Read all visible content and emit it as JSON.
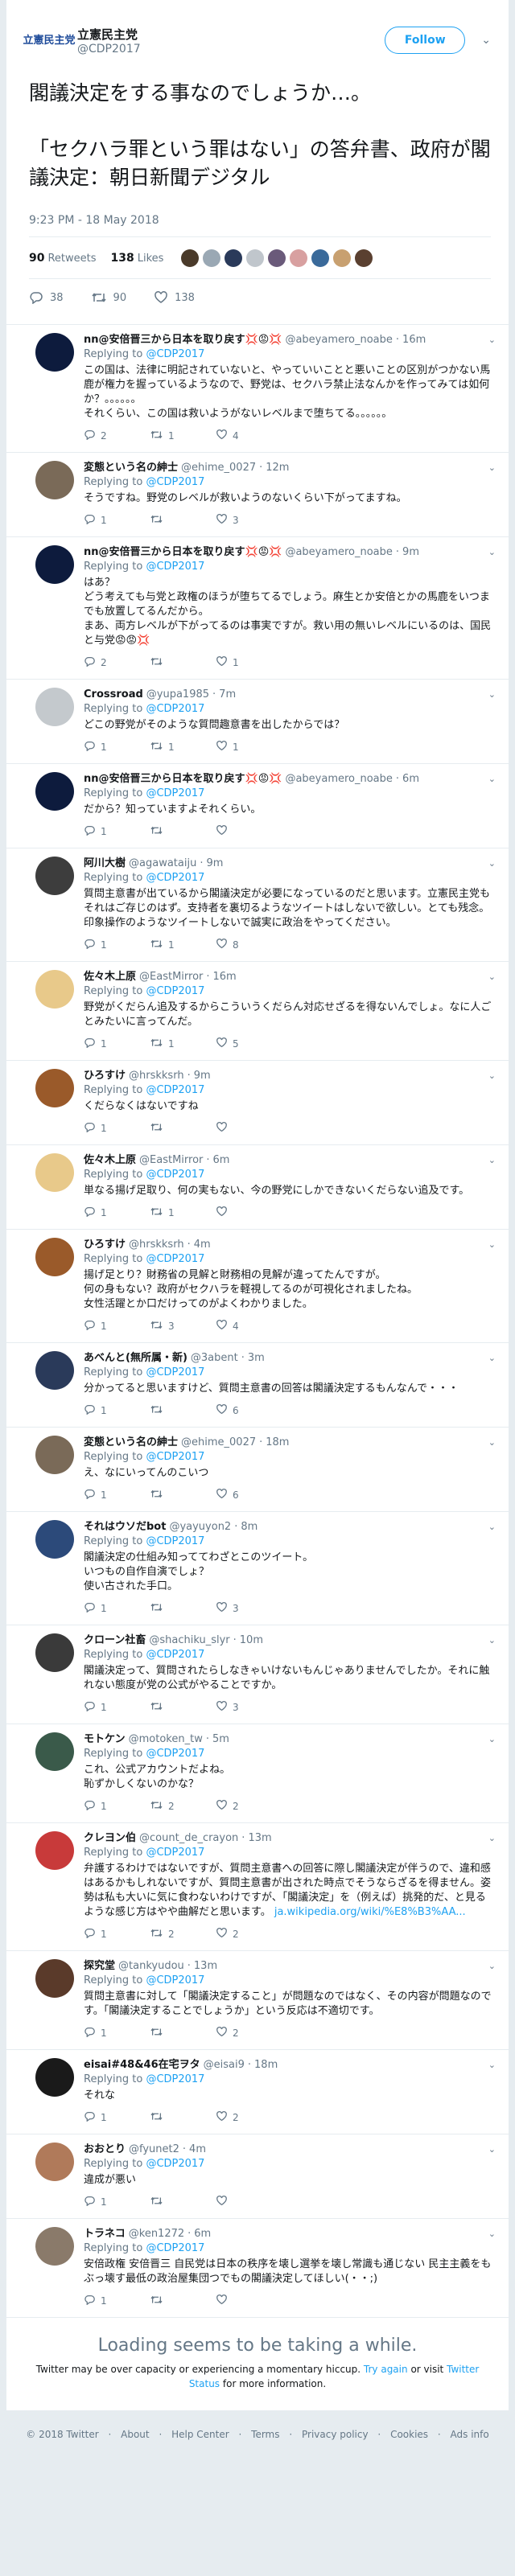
{
  "main": {
    "account_name": "立憲民主党",
    "handle": "@CDP2017",
    "logo_text": "立憲民主党",
    "follow_label": "Follow",
    "text": "閣議決定をする事なのでしょうか…。\n\n「セクハラ罪という罪はない」の答弁書、政府が閣議決定：朝日新聞デジタル",
    "timestamp": "9:23 PM - 18 May 2018",
    "retweets_count": "90",
    "retweets_label": "Retweets",
    "likes_count": "138",
    "likes_label": "Likes",
    "reply_count": "38",
    "retweet_count": "90",
    "like_count": "138"
  },
  "replying_label": "Replying to",
  "replying_handle": "@CDP2017",
  "replies": [
    {
      "name": "nn@安倍晋三から日本を取り戻す💢😡💢",
      "handle": "@abeyamero_noabe",
      "time": "16m",
      "text": "この国は、法律に明記されていないと、やっていいことと悪いことの区別がつかない馬鹿が権力を握っているようなので、野党は、セクハラ禁止法なんかを作ってみては如何か？。。。。。。\nそれくらい、この国は救いようがないレベルまで堕ちてる。。。。。。",
      "reply": "2",
      "rt": "1",
      "like": "4",
      "color": "#0d1b3d"
    },
    {
      "name": "変態という名の紳士",
      "handle": "@ehime_0027",
      "time": "12m",
      "text": "そうですね。野党のレベルが救いようのないくらい下がってますね。",
      "reply": "1",
      "rt": "",
      "like": "3",
      "color": "#7a6a58"
    },
    {
      "name": "nn@安倍晋三から日本を取り戻す💢😡💢",
      "handle": "@abeyamero_noabe",
      "time": "9m",
      "text": "はあ？\nどう考えても与党と政権のほうが堕ちてるでしょう。麻生とか安倍とかの馬鹿をいつまでも放置してるんだから。\nまあ、両方レベルが下がってるのは事実ですが。救い用の無いレベルにいるのは、国民と与党😡😡💢",
      "reply": "2",
      "rt": "",
      "like": "1",
      "color": "#0d1b3d"
    },
    {
      "name": "Crossroad",
      "handle": "@yupa1985",
      "time": "7m",
      "text": "どこの野党がそのような質問趣意書を出したからでは？",
      "reply": "1",
      "rt": "1",
      "like": "1",
      "color": "#c4c9cd"
    },
    {
      "name": "nn@安倍晋三から日本を取り戻す💢😡💢",
      "handle": "@abeyamero_noabe",
      "time": "6m",
      "text": "だから？知っていますよそれくらい。",
      "reply": "1",
      "rt": "",
      "like": "",
      "color": "#0d1b3d"
    },
    {
      "name": "阿川大樹",
      "handle": "@agawataiju",
      "time": "9m",
      "text": "質問主意書が出ているから閣議決定が必要になっているのだと思います。立憲民主党もそれはご存じのはず。支持者を裏切るようなツイートはしないで欲しい。とても残念。印象操作のようなツイートしないで誠実に政治をやってください。",
      "reply": "1",
      "rt": "1",
      "like": "8",
      "color": "#3d3d3d"
    },
    {
      "name": "佐々木上原",
      "handle": "@EastMirror",
      "time": "16m",
      "text": "野党がくだらん追及するからこういうくだらん対応せざるを得ないんでしょ。なに人ごとみたいに言ってんだ。",
      "reply": "1",
      "rt": "1",
      "like": "5",
      "color": "#e8c98a"
    },
    {
      "name": "ひろすけ",
      "handle": "@hrskksrh",
      "time": "9m",
      "text": "くだらなくはないですね",
      "reply": "1",
      "rt": "",
      "like": "",
      "color": "#9a5a2a"
    },
    {
      "name": "佐々木上原",
      "handle": "@EastMirror",
      "time": "6m",
      "text": "単なる揚げ足取り、何の実もない、今の野党にしかできないくだらない追及です。",
      "reply": "1",
      "rt": "1",
      "like": "",
      "color": "#e8c98a"
    },
    {
      "name": "ひろすけ",
      "handle": "@hrskksrh",
      "time": "4m",
      "text": "揚げ足とり？財務省の見解と財務相の見解が違ってたんですが。\n何の身もない？政府がセクハラを軽視してるのが可視化されましたね。\n女性活躍とか口だけってのがよくわかりました。",
      "reply": "1",
      "rt": "3",
      "like": "4",
      "color": "#9a5a2a"
    },
    {
      "name": "あべんと(無所属・新)",
      "handle": "@3abent",
      "time": "3m",
      "text": "分かってると思いますけど、質問主意書の回答は閣議決定するもんなんで・・・",
      "reply": "1",
      "rt": "",
      "like": "6",
      "color": "#2a3a5a"
    },
    {
      "name": "変態という名の紳士",
      "handle": "@ehime_0027",
      "time": "18m",
      "text": "え、なにいってんのこいつ",
      "reply": "1",
      "rt": "",
      "like": "6",
      "color": "#7a6a58"
    },
    {
      "name": "それはウソだbot",
      "handle": "@yayuyon2",
      "time": "8m",
      "text": "閣議決定の仕組み知っててわざとこのツイート。\nいつもの自作自演でしょ？\n使い古された手口。",
      "reply": "1",
      "rt": "",
      "like": "3",
      "color": "#2c4a7a"
    },
    {
      "name": "クローン社畜",
      "handle": "@shachiku_slyr",
      "time": "10m",
      "text": "閣議決定って、質問されたらしなきゃいけないもんじゃありませんでしたか。それに触れない態度が党の公式がやることですか。",
      "reply": "1",
      "rt": "",
      "like": "3",
      "color": "#3a3a3a"
    },
    {
      "name": "モトケン",
      "handle": "@motoken_tw",
      "time": "5m",
      "text": "これ、公式アカウントだよね。\n恥ずかしくないのかな？",
      "reply": "1",
      "rt": "2",
      "like": "2",
      "color": "#3a5a4a"
    },
    {
      "name": "クレヨン伯",
      "handle": "@count_de_crayon",
      "time": "13m",
      "text": "弁護するわけではないですが、質問主意書への回答に際し閣議決定が伴うので、違和感はあるかもしれないですが、質問主意書が出された時点でそうならざるを得ません。姿勢は私も大いに気に食わないわけですが、「閣議決定」を（例えば）挑発的だ、と見るような感じ方はやや曲解だと思います。",
      "link": "ja.wikipedia.org/wiki/%E8%B3%AA...",
      "reply": "1",
      "rt": "2",
      "like": "2",
      "color": "#c83a3a"
    },
    {
      "name": "探究堂",
      "handle": "@tankyudou",
      "time": "13m",
      "text": "質問主意書に対して「閣議決定すること」が問題なのではなく、その内容が問題なのです。「閣議決定することでしょうか」という反応は不適切です。",
      "reply": "1",
      "rt": "",
      "like": "2",
      "color": "#5a3a2a"
    },
    {
      "name": "eisai#48&46在宅ヲタ",
      "handle": "@eisai9",
      "time": "18m",
      "text": "それな",
      "reply": "1",
      "rt": "",
      "like": "2",
      "color": "#1a1a1a"
    },
    {
      "name": "おおとり",
      "handle": "@fyunet2",
      "time": "4m",
      "text": "違成が悪い",
      "reply": "1",
      "rt": "",
      "like": "",
      "color": "#b07a5a"
    },
    {
      "name": "トラネコ",
      "handle": "@ken1272",
      "time": "6m",
      "text": "安倍政権 安倍晋三 自民党は日本の秩序を壊し選挙を壊し常識も通じない 民主主義をもぶっ壊す最低の政治屋集団つでもの閣議決定してほしい(・・;)",
      "reply": "1",
      "rt": "",
      "like": "",
      "color": "#8a7a6a"
    }
  ],
  "loading": {
    "title": "Loading seems to be taking a while.",
    "text_before": "Twitter may be over capacity or experiencing a momentary hiccup.",
    "try_again": "Try again",
    "or_visit": "or visit",
    "status_link": "Twitter Status",
    "text_after": "for more information."
  },
  "footer": {
    "copyright": "© 2018 Twitter",
    "links": [
      "About",
      "Help Center",
      "Terms",
      "Privacy policy",
      "Cookies",
      "Ads info"
    ]
  },
  "colors": {
    "accent": "#1da1f2",
    "muted": "#657786",
    "text": "#14171a",
    "background": "#e6ecf0"
  }
}
